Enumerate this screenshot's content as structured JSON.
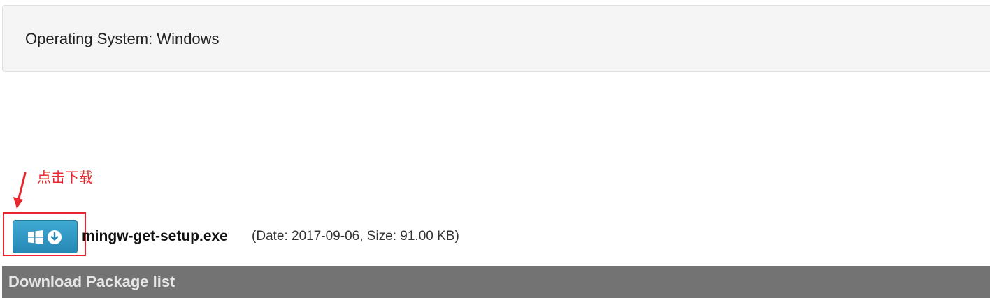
{
  "os_info": {
    "label": "Operating System: Windows"
  },
  "annotation": {
    "text": "点击下载",
    "color": "#e8262d"
  },
  "download": {
    "button_icons": [
      "windows-icon",
      "download-circle-icon"
    ],
    "button_color": "#2f97c6",
    "file_name": "mingw-get-setup.exe",
    "meta": "(Date: 2017-09-06, Size: 91.00 KB)"
  },
  "package_list": {
    "title": "Download Package list",
    "background": "#737373"
  }
}
